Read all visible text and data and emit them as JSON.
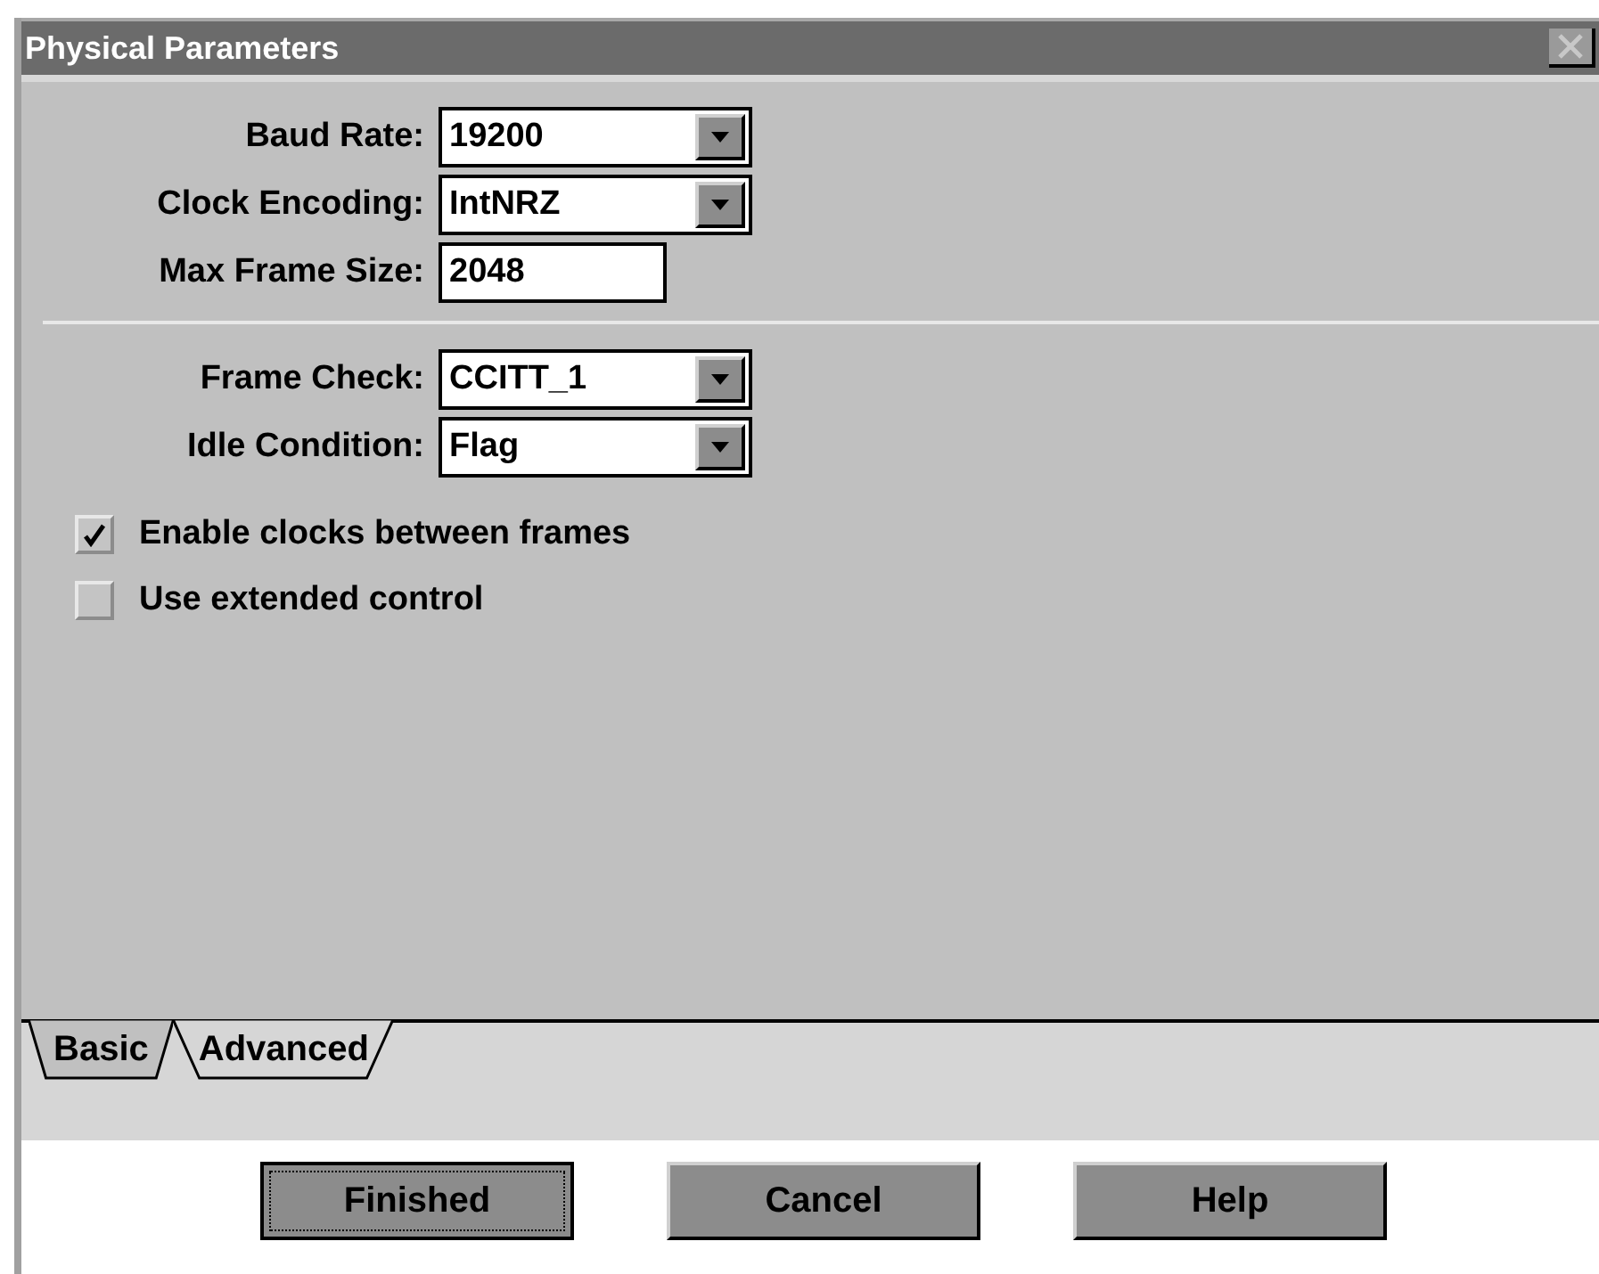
{
  "window": {
    "title": "Physical Parameters"
  },
  "section_1": [
    {
      "kind": "dropdown",
      "label": "Baud Rate:",
      "value": "19200"
    },
    {
      "kind": "dropdown",
      "label": "Clock Encoding:",
      "value": "IntNRZ"
    },
    {
      "kind": "text",
      "label": "Max Frame Size:",
      "value": "2048"
    }
  ],
  "section_2": [
    {
      "kind": "dropdown",
      "label": "Frame Check:",
      "value": "CCITT_1"
    },
    {
      "kind": "dropdown",
      "label": "Idle Condition:",
      "value": "Flag"
    }
  ],
  "checkboxes": [
    {
      "label": "Enable clocks between frames",
      "checked": true
    },
    {
      "label": "Use extended control",
      "checked": false
    }
  ],
  "tabs": [
    {
      "label": "Basic",
      "selected": true
    },
    {
      "label": "Advanced",
      "selected": false
    }
  ],
  "buttons": [
    {
      "label": "Finished",
      "focused": true
    },
    {
      "label": "Cancel",
      "focused": false
    },
    {
      "label": "Help",
      "focused": false
    }
  ]
}
